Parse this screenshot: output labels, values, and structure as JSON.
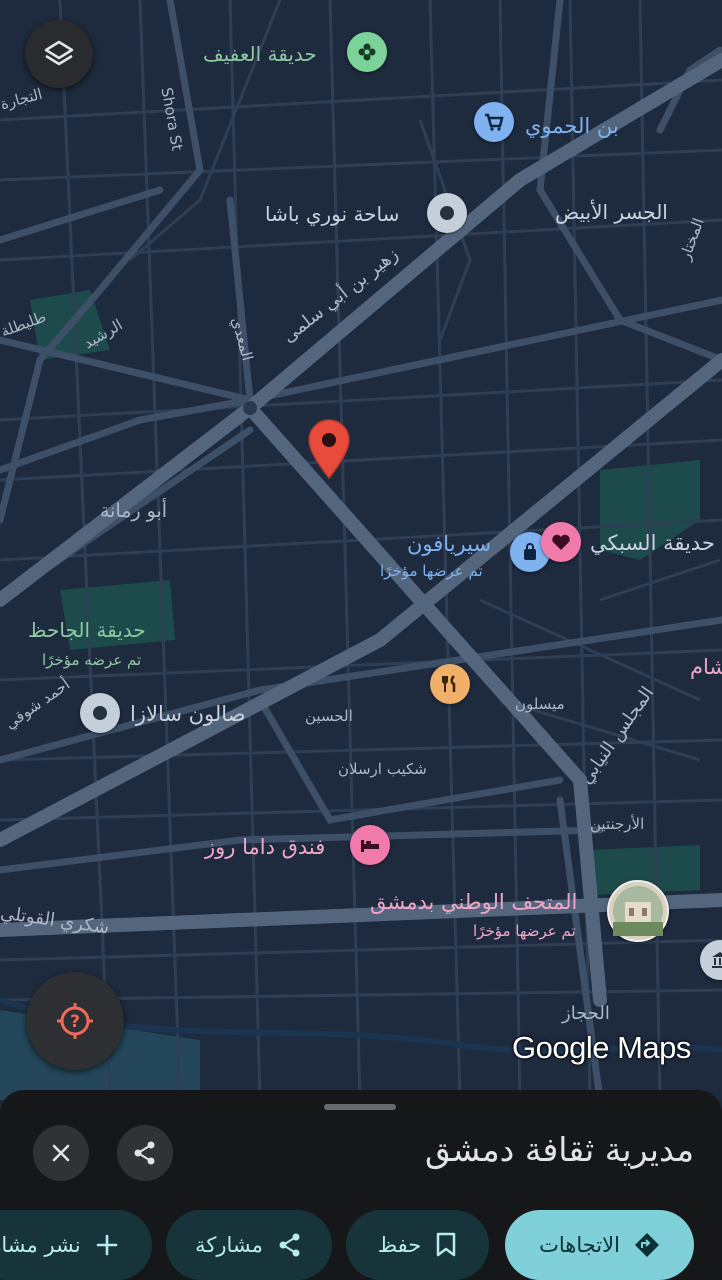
{
  "map": {
    "road_labels": {
      "shora": "Shora St",
      "zuhair": "زهير بن أبي سلمى",
      "rashid": "الرشيد",
      "maadi": "المعدي",
      "tulaytla": "طليطلة",
      "tijara": "التجارة",
      "abu_rummaneh": "أبو رمانة",
      "hussein": "الحسين",
      "shakib": "شكيب ارسلان",
      "maysaloun": "ميسلون",
      "majlis": "المجلس النيابي",
      "argentina": "الأرجنتين",
      "shukri": "شكري القوتلي",
      "hijaz": "الحجاز",
      "ahmad_shawqi": "أحمد شوقي",
      "mukhtar": "المختار"
    },
    "places": {
      "afif_garden": "حديقة العفيف",
      "hamawi": "بن الحموي",
      "nouri_basha": "ساحة نوري باشا",
      "white_bridge": "الجسر الأبيض",
      "syriafone": "سيريافون",
      "syriafone_note": "تم عرضها مؤخرًا",
      "sabki_garden": "حديقة السبكي",
      "jahiz_garden": "حديقة الجاحظ",
      "jahiz_note": "تم عرضه مؤخرًا",
      "salon": "صالون سالازا",
      "dama_rose": "فندق داما روز",
      "museum": "المتحف الوطني بدمشق",
      "museum_note": "تم عرضها مؤخرًا",
      "sham_partial": "شام"
    },
    "pin_icons": {
      "afif_garden": "flower-icon",
      "hamawi": "shopping-cart-icon",
      "nouri_basha": "landmark-dot-icon",
      "syriafone": "shopping-bag-icon",
      "sabki_garden": "heart-icon",
      "restaurant": "fork-knife-icon",
      "salon": "landmark-dot-icon",
      "dama_rose": "bed-icon",
      "museum": "photo-thumbnail",
      "selected": "red-location-pin"
    },
    "colors": {
      "background": "#1e2a3d",
      "road": "#3d5068",
      "major_road": "#54667d",
      "park": "#1d4a4a",
      "selected_pin": "#e84b3c",
      "accent_teal": "#7fd0d8"
    }
  },
  "brand": {
    "logo": "Google Maps"
  },
  "controls": {
    "layers": "layers-icon",
    "my_location": "location-unknown-icon"
  },
  "sheet": {
    "title": "مديرية ثقافة دمشق",
    "close_icon": "close-icon",
    "share_icon": "share-icon",
    "actions": {
      "directions": "الاتجاهات",
      "save": "حفظ",
      "share": "مشاركة",
      "post": "نشر مشاركة"
    }
  }
}
